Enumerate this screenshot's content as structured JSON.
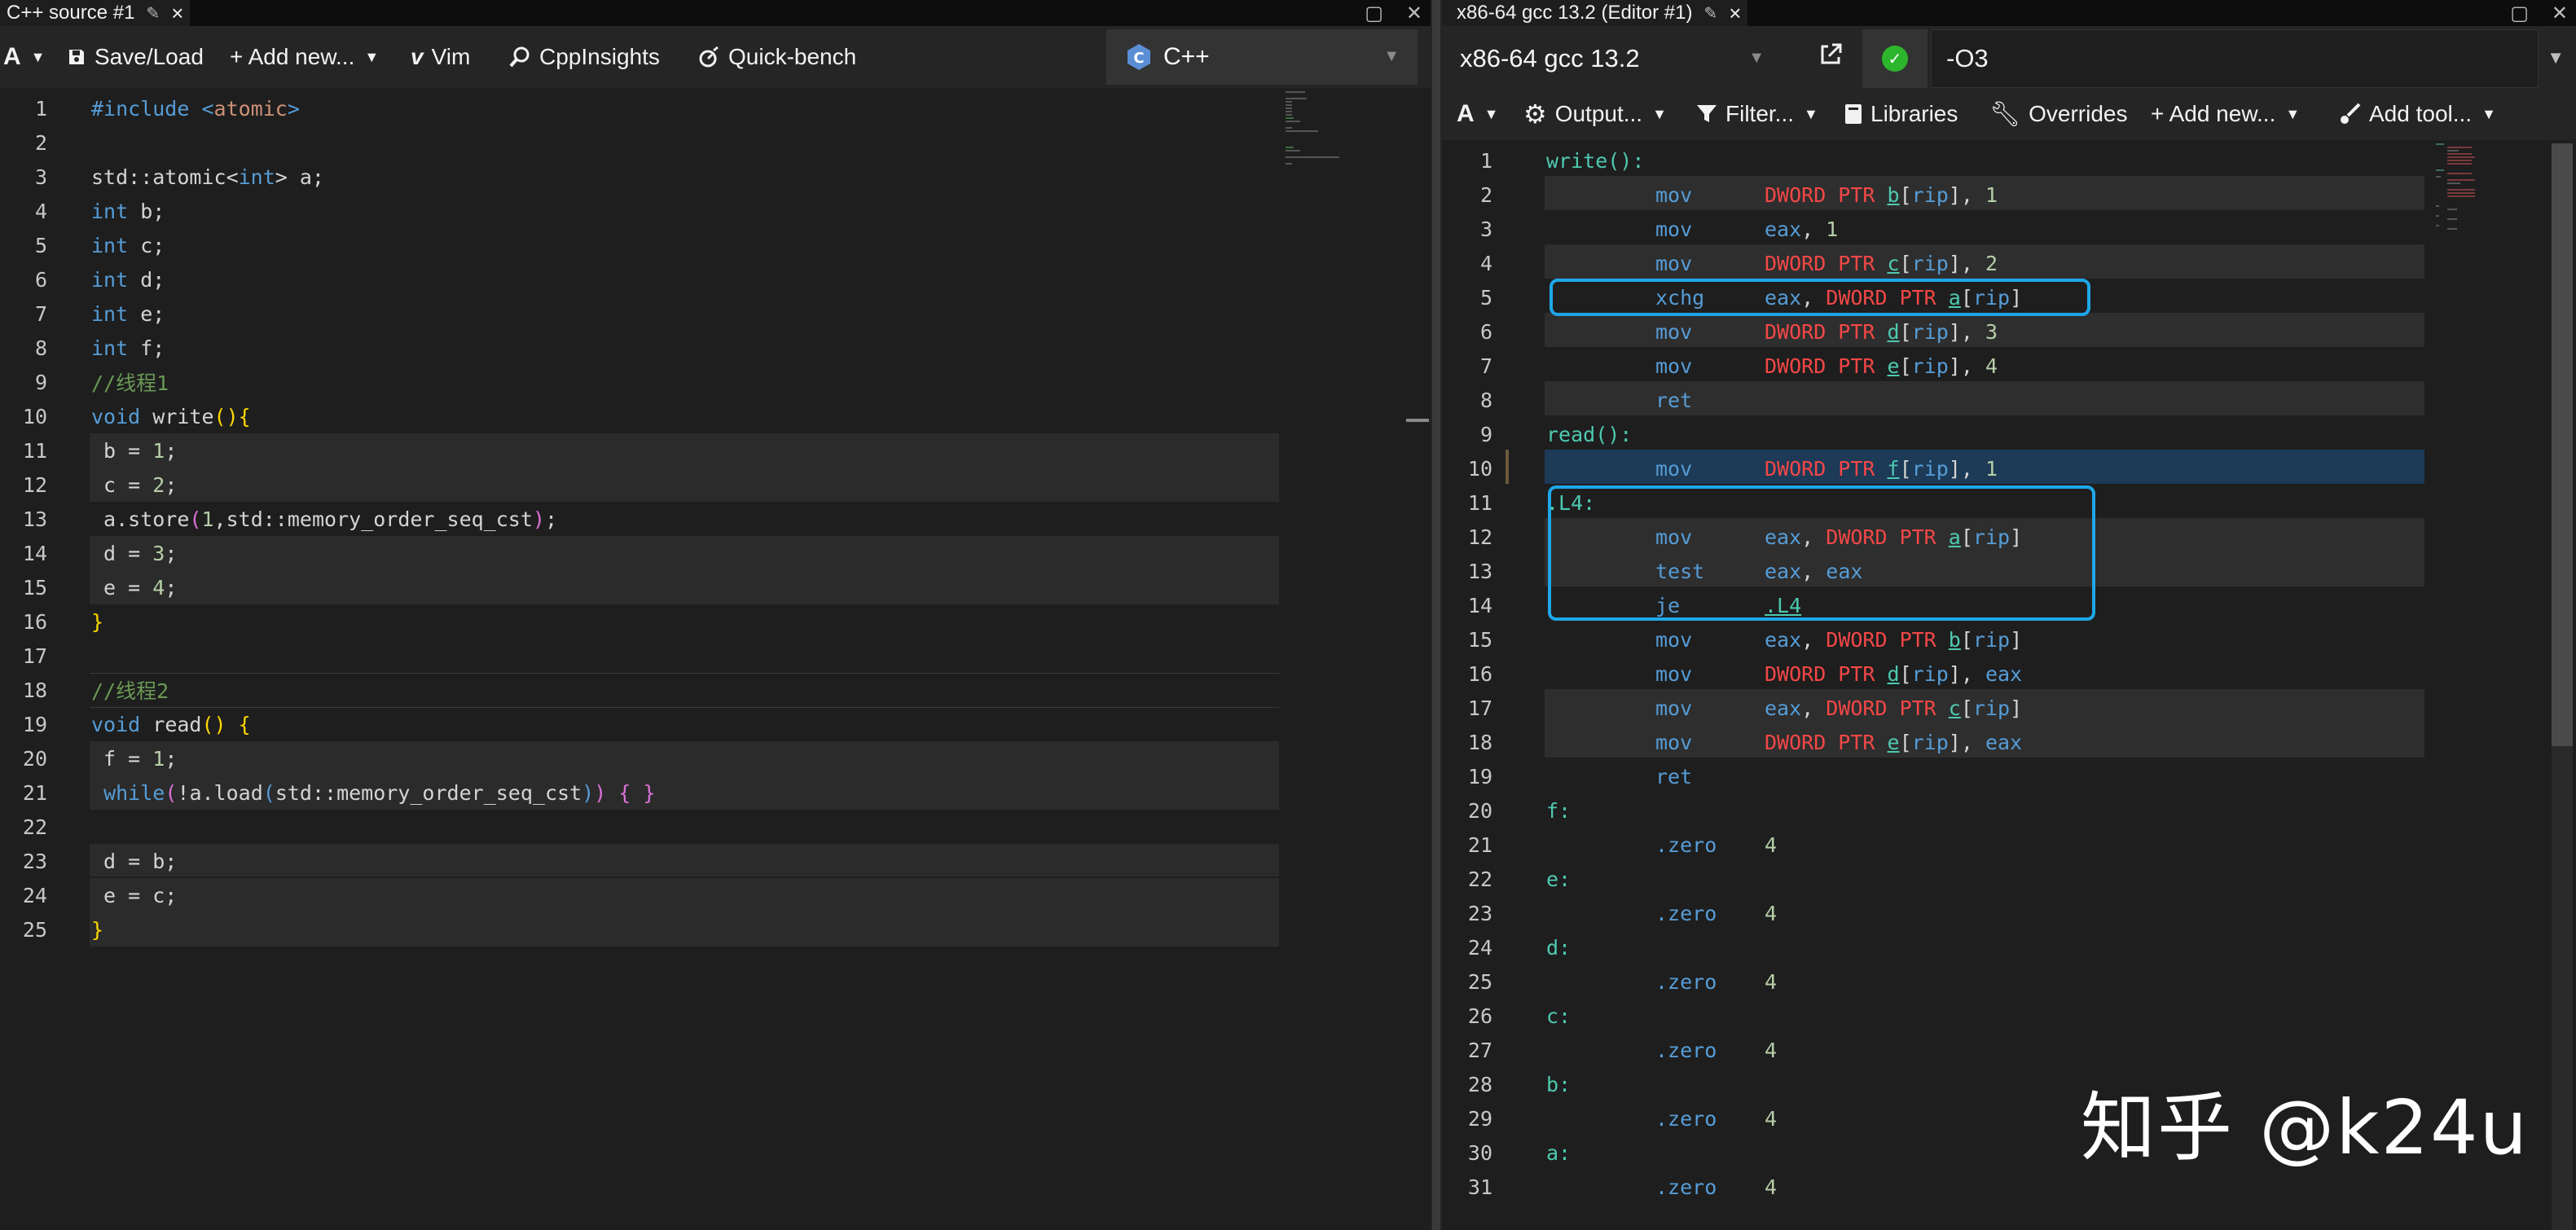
{
  "left": {
    "tab_title": "C++ source #1",
    "toolbar": {
      "font_label": "A",
      "save_load": "Save/Load",
      "add_new": "+ Add new...",
      "vim": "Vim",
      "cppinsights": "CppInsights",
      "quickbench": "Quick-bench"
    },
    "language": "C++",
    "lines": [
      {
        "n": "1",
        "code": "#include <atomic>"
      },
      {
        "n": "2",
        "code": ""
      },
      {
        "n": "3",
        "code": "std::atomic<int> a;"
      },
      {
        "n": "4",
        "code": "int b;"
      },
      {
        "n": "5",
        "code": "int c;"
      },
      {
        "n": "6",
        "code": "int d;"
      },
      {
        "n": "7",
        "code": "int e;"
      },
      {
        "n": "8",
        "code": "int f;"
      },
      {
        "n": "9",
        "code": "//线程1"
      },
      {
        "n": "10",
        "code": "void write(){"
      },
      {
        "n": "11",
        "code": " b = 1;"
      },
      {
        "n": "12",
        "code": " c = 2;"
      },
      {
        "n": "13",
        "code": " a.store(1,std::memory_order_seq_cst);"
      },
      {
        "n": "14",
        "code": " d = 3;"
      },
      {
        "n": "15",
        "code": " e = 4;"
      },
      {
        "n": "16",
        "code": "}"
      },
      {
        "n": "17",
        "code": ""
      },
      {
        "n": "18",
        "code": "//线程2"
      },
      {
        "n": "19",
        "code": "void read() {"
      },
      {
        "n": "20",
        "code": " f = 1;"
      },
      {
        "n": "21",
        "code": " while(!a.load(std::memory_order_seq_cst)) { }"
      },
      {
        "n": "22",
        "code": ""
      },
      {
        "n": "23",
        "code": " d = b;"
      },
      {
        "n": "24",
        "code": " e = c;"
      },
      {
        "n": "25",
        "code": "}"
      }
    ]
  },
  "right": {
    "tab_title": "x86-64 gcc 13.2 (Editor #1)",
    "compiler": "x86-64 gcc 13.2",
    "flags": "-O3",
    "toolbar": {
      "font_label": "A",
      "output": "Output...",
      "filter": "Filter...",
      "libraries": "Libraries",
      "overrides": "Overrides",
      "add_new": "+ Add new...",
      "add_tool": "Add tool..."
    },
    "lines": [
      {
        "n": "1",
        "label": "write():",
        "op": "",
        "args": ""
      },
      {
        "n": "2",
        "label": "",
        "op": "mov",
        "args": "DWORD PTR b[rip], 1"
      },
      {
        "n": "3",
        "label": "",
        "op": "mov",
        "args": "eax, 1"
      },
      {
        "n": "4",
        "label": "",
        "op": "mov",
        "args": "DWORD PTR c[rip], 2"
      },
      {
        "n": "5",
        "label": "",
        "op": "xchg",
        "args": "eax, DWORD PTR a[rip]"
      },
      {
        "n": "6",
        "label": "",
        "op": "mov",
        "args": "DWORD PTR d[rip], 3"
      },
      {
        "n": "7",
        "label": "",
        "op": "mov",
        "args": "DWORD PTR e[rip], 4"
      },
      {
        "n": "8",
        "label": "",
        "op": "ret",
        "args": ""
      },
      {
        "n": "9",
        "label": "read():",
        "op": "",
        "args": ""
      },
      {
        "n": "10",
        "label": "",
        "op": "mov",
        "args": "DWORD PTR f[rip], 1"
      },
      {
        "n": "11",
        "label": ".L4:",
        "op": "",
        "args": ""
      },
      {
        "n": "12",
        "label": "",
        "op": "mov",
        "args": "eax, DWORD PTR a[rip]"
      },
      {
        "n": "13",
        "label": "",
        "op": "test",
        "args": "eax, eax"
      },
      {
        "n": "14",
        "label": "",
        "op": "je",
        "args": ".L4"
      },
      {
        "n": "15",
        "label": "",
        "op": "mov",
        "args": "eax, DWORD PTR b[rip]"
      },
      {
        "n": "16",
        "label": "",
        "op": "mov",
        "args": "DWORD PTR d[rip], eax"
      },
      {
        "n": "17",
        "label": "",
        "op": "mov",
        "args": "eax, DWORD PTR c[rip]"
      },
      {
        "n": "18",
        "label": "",
        "op": "mov",
        "args": "DWORD PTR e[rip], eax"
      },
      {
        "n": "19",
        "label": "",
        "op": "ret",
        "args": ""
      },
      {
        "n": "20",
        "label": "f:",
        "op": "",
        "args": ""
      },
      {
        "n": "21",
        "label": "",
        "op": ".zero",
        "args": "4"
      },
      {
        "n": "22",
        "label": "e:",
        "op": "",
        "args": ""
      },
      {
        "n": "23",
        "label": "",
        "op": ".zero",
        "args": "4"
      },
      {
        "n": "24",
        "label": "d:",
        "op": "",
        "args": ""
      },
      {
        "n": "25",
        "label": "",
        "op": ".zero",
        "args": "4"
      },
      {
        "n": "26",
        "label": "c:",
        "op": "",
        "args": ""
      },
      {
        "n": "27",
        "label": "",
        "op": ".zero",
        "args": "4"
      },
      {
        "n": "28",
        "label": "b:",
        "op": "",
        "args": ""
      },
      {
        "n": "29",
        "label": "",
        "op": ".zero",
        "args": "4"
      },
      {
        "n": "30",
        "label": "a:",
        "op": "",
        "args": ""
      },
      {
        "n": "31",
        "label": "",
        "op": ".zero",
        "args": "4"
      }
    ]
  },
  "watermark": "知乎 @k24u",
  "colors": {
    "highlight_box": "#1ea7e8",
    "ok_green": "#2db52d"
  }
}
